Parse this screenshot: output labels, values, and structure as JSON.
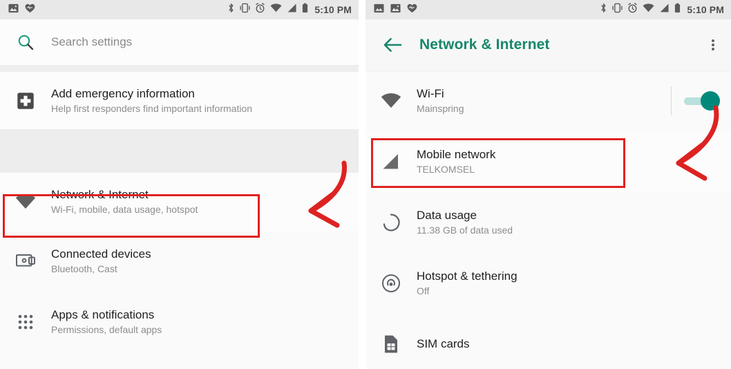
{
  "theme": {
    "accent": "#17876b",
    "toggle_on": "#00897b",
    "toggle_track": "#b9e0da",
    "annotation_red": "#e02020",
    "text_primary": "#1f1f1f",
    "text_secondary": "#8d8d8d",
    "statusbar_bg": "#e8e8e8"
  },
  "left_screen": {
    "name": "settings-home",
    "statusbar": {
      "time": "5:10 PM",
      "left_icons": [
        "image-icon",
        "heart-health-icon"
      ],
      "right_icons": [
        "bluetooth-icon",
        "vibrate-icon",
        "alarm-icon",
        "wifi-icon",
        "signal-icon",
        "battery-icon"
      ]
    },
    "search": {
      "icon": "search-icon",
      "placeholder": "Search settings",
      "value": ""
    },
    "emergency": {
      "icon": "emergency-plus-icon",
      "title": "Add emergency information",
      "subtitle": "Help first responders find important information"
    },
    "items": [
      {
        "icon": "wifi-icon",
        "title": "Network & Internet",
        "subtitle": "Wi-Fi, mobile, data usage, hotspot",
        "highlighted": "true"
      },
      {
        "icon": "connected-devices-icon",
        "title": "Connected devices",
        "subtitle": "Bluetooth, Cast",
        "highlighted": "false"
      },
      {
        "icon": "apps-grid-icon",
        "title": "Apps & notifications",
        "subtitle": "Permissions, default apps",
        "highlighted": "false"
      }
    ]
  },
  "right_screen": {
    "name": "network-and-internet",
    "statusbar": {
      "time": "5:10 PM",
      "left_icons": [
        "screenshot-icon",
        "image-icon",
        "heart-health-icon"
      ],
      "right_icons": [
        "bluetooth-icon",
        "vibrate-icon",
        "alarm-icon",
        "wifi-icon",
        "signal-icon",
        "battery-icon"
      ]
    },
    "appbar": {
      "back_icon": "back-arrow-icon",
      "title": "Network & Internet",
      "overflow_icon": "overflow-menu-icon"
    },
    "items": [
      {
        "icon": "wifi-icon",
        "title": "Wi-Fi",
        "subtitle": "Mainspring",
        "has_toggle": "true",
        "toggle_state": "on",
        "highlighted": "false"
      },
      {
        "icon": "signal-icon",
        "title": "Mobile network",
        "subtitle": "TELKOMSEL",
        "has_toggle": "false",
        "highlighted": "true"
      },
      {
        "icon": "data-usage-icon",
        "title": "Data usage",
        "subtitle": "11.38 GB of data used",
        "has_toggle": "false",
        "highlighted": "false"
      },
      {
        "icon": "hotspot-icon",
        "title": "Hotspot & tethering",
        "subtitle": "Off",
        "has_toggle": "false",
        "highlighted": "false"
      },
      {
        "icon": "sim-card-icon",
        "title": "SIM cards",
        "subtitle": "",
        "has_toggle": "false",
        "highlighted": "false"
      }
    ]
  },
  "annotations": [
    {
      "name": "arrow-to-network-and-internet",
      "target": "Network & Internet row (left screen)"
    },
    {
      "name": "arrow-to-mobile-network",
      "target": "Mobile network row (right screen)"
    }
  ]
}
